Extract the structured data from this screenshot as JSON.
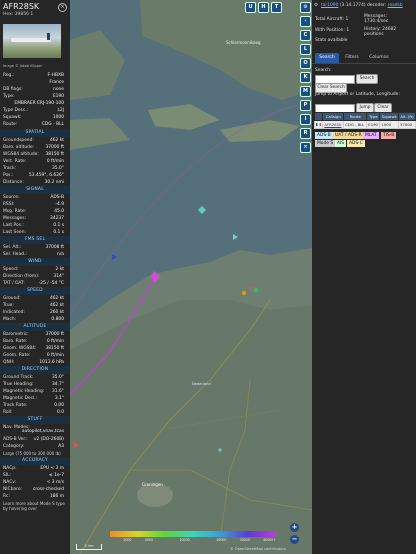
{
  "left_panel": {
    "callsign": "AFR28SK",
    "hex": "Hex: 39856 1",
    "hex_value": "39856 1",
    "image_credit": "Image © Jakob Klipper",
    "overview": [
      {
        "k": "Reg.:",
        "v": "F-HBXB"
      },
      {
        "k": "",
        "v": "France"
      },
      {
        "k": "DB flags:",
        "v": "none"
      },
      {
        "k": "Type:",
        "v": "E190"
      },
      {
        "k": "",
        "v": "EMBRAER ERJ-190-100"
      },
      {
        "k": "Type Desc.:",
        "v": "L2J"
      },
      {
        "k": "Squawk:",
        "v": "1000"
      },
      {
        "k": "Route:",
        "v": "CDG - BLL"
      }
    ],
    "sections": [
      {
        "title": "SPATIAL",
        "rows": [
          {
            "k": "Groundspeed:",
            "v": "462 kt"
          },
          {
            "k": "Baro. altitude:",
            "v": "37000 ft"
          },
          {
            "k": "WGS84 altitude:",
            "v": "38150 ft"
          },
          {
            "k": "Vert. Rate:",
            "v": "0 ft/min"
          },
          {
            "k": "Track:",
            "v": "35.0°"
          },
          {
            "k": "Pos.:",
            "v": "53.459°, 6.626°"
          },
          {
            "k": "Distance:",
            "v": "30.2 nmi"
          }
        ]
      },
      {
        "title": "SIGNAL",
        "rows": [
          {
            "k": "Source:",
            "v": "ADS-B"
          },
          {
            "k": "RSSI:",
            "v": "-4.9"
          },
          {
            "k": "Msg. Rate:",
            "v": "45.0"
          },
          {
            "k": "Messages:",
            "v": "34237"
          },
          {
            "k": "Last Pos.:",
            "v": "0.1 s"
          },
          {
            "k": "Last Seen:",
            "v": "0.1 s"
          }
        ]
      },
      {
        "title": "FMS SEL",
        "rows": [
          {
            "k": "Sel. Alt.:",
            "v": "37008 ft"
          },
          {
            "k": "Sel. Head.:",
            "v": "n/a"
          }
        ]
      },
      {
        "title": "WIND",
        "rows": [
          {
            "k": "Speed:",
            "v": "2 kt"
          },
          {
            "k": "Direction (from):",
            "v": "314°"
          },
          {
            "k": "TAT / OAT:",
            "v": "-25 / -54 °C"
          }
        ]
      },
      {
        "title": "SPEED",
        "rows": [
          {
            "k": "Ground:",
            "v": "462 kt"
          },
          {
            "k": "True:",
            "v": "462 kt"
          },
          {
            "k": "Indicated:",
            "v": "260 kt"
          },
          {
            "k": "Mach:",
            "v": "0.800"
          }
        ]
      },
      {
        "title": "ALTITUDE",
        "rows": [
          {
            "k": "Barometric:",
            "v": "37000 ft"
          },
          {
            "k": "Baro. Rate:",
            "v": "0 ft/min"
          },
          {
            "k": "Geom. WGS84:",
            "v": "38150 ft"
          },
          {
            "k": "Geom. Rate:",
            "v": "0 ft/min"
          },
          {
            "k": "QNH:",
            "v": "1013.6 hPa"
          }
        ]
      },
      {
        "title": "DIRECTION",
        "rows": [
          {
            "k": "Ground Track:",
            "v": "35.0°"
          },
          {
            "k": "True Heading:",
            "v": "34.7°"
          },
          {
            "k": "Magnetic Heading:",
            "v": "31.6°"
          },
          {
            "k": "Magnetic Decl.:",
            "v": "3.1°"
          },
          {
            "k": "Track Rate:",
            "v": "0.00"
          },
          {
            "k": "Roll:",
            "v": "0.0"
          }
        ]
      }
    ],
    "stuff": {
      "title": "STUFF",
      "nav_modes_k": "Nav. Modes:",
      "nav_modes_v": "autopilot,vnav,tcas",
      "adsb_ver_k": "ADS-B Ver.:",
      "adsb_ver_v": "v2 (DO-260B)",
      "category_k": "Category:",
      "category_v": "A3",
      "category_desc": "Large (75 000 to 300 000 lb)"
    },
    "accuracy": {
      "title": "ACCURACY",
      "rows": [
        {
          "k": "NACp:",
          "v": "EPU < 3 m"
        },
        {
          "k": "SIL:",
          "v": "≤ 1e-7"
        },
        {
          "k": "NACv:",
          "v": "< 3 m/s"
        },
        {
          "k": "NICbaro:",
          "v": "cross-checked"
        },
        {
          "k": "Rc:",
          "v": "186 m"
        }
      ]
    },
    "footer_note": "Learn more about Mode S type by hovering over"
  },
  "map": {
    "top_buttons": [
      "U",
      "H",
      "T"
    ],
    "side_buttons": [
      "C",
      "L",
      "O",
      "K",
      "M",
      "P",
      "I",
      "R"
    ],
    "side_extra_icons": [
      "settings-icon",
      "close-icon"
    ],
    "labels": [
      {
        "name": "island-label",
        "text": "Schiermonnikoog"
      },
      {
        "name": "city-label",
        "text": "Groningen"
      },
      {
        "name": "country-label",
        "text": "Nederland"
      }
    ],
    "scale_label": "5 nm",
    "altitude_scale": [
      "",
      "2000",
      "4000",
      "",
      "10000",
      "",
      "20000",
      "30000",
      "40000+"
    ],
    "attribution": "© OpenStreetMap contributors",
    "zoom_in": "+",
    "zoom_out": "−",
    "colors": {
      "water": "#566c76",
      "land": "#6d7d6f",
      "track": "#c040d0"
    }
  },
  "right_panel": {
    "version_link": "tar1090",
    "version_text": "(3.14.1774) decoder:",
    "decoder_link": "readsb",
    "stats": {
      "total_label": "Total Aircraft: 1",
      "position_label": "With Position: 1",
      "messages_label": "Messages:",
      "messages_value": "1730.4/sec",
      "history_label": "History: 24682",
      "history_value": "positions",
      "stats_label": "Stats available"
    },
    "tabs": [
      "Search",
      "Filters",
      "Columns"
    ],
    "search_label": "Search:",
    "search_button": "Search",
    "clear_search_button": "Clear Search",
    "jump_label": "Jump to Airport or Latitude, Longitude:",
    "jump_button": "Jump",
    "clear_button": "Clear",
    "table_headers": [
      "",
      "Callsign",
      "Route",
      "Type",
      "Squawk",
      "Alt. (ft)"
    ],
    "table_rows": [
      {
        "flag": "",
        "callsign": "AFR28SK",
        "route": "CDG - BLL",
        "type": "E190",
        "squawk": "1000",
        "alt": "37000"
      }
    ],
    "legend": [
      {
        "text": "ADS-B",
        "color": "#c6e7ff"
      },
      {
        "text": "UAT / ADS-R",
        "color": "#f0d896"
      },
      {
        "text": "MLAT",
        "color": "#e6b0ff"
      },
      {
        "text": "TIS-B",
        "color": "#f5a9a9"
      },
      {
        "text": "Mode S",
        "color": "#c8c8c8"
      },
      {
        "text": "AIS",
        "color": "#d4ffd4"
      },
      {
        "text": "ADS-C",
        "color": "#f6e8b0"
      }
    ]
  }
}
